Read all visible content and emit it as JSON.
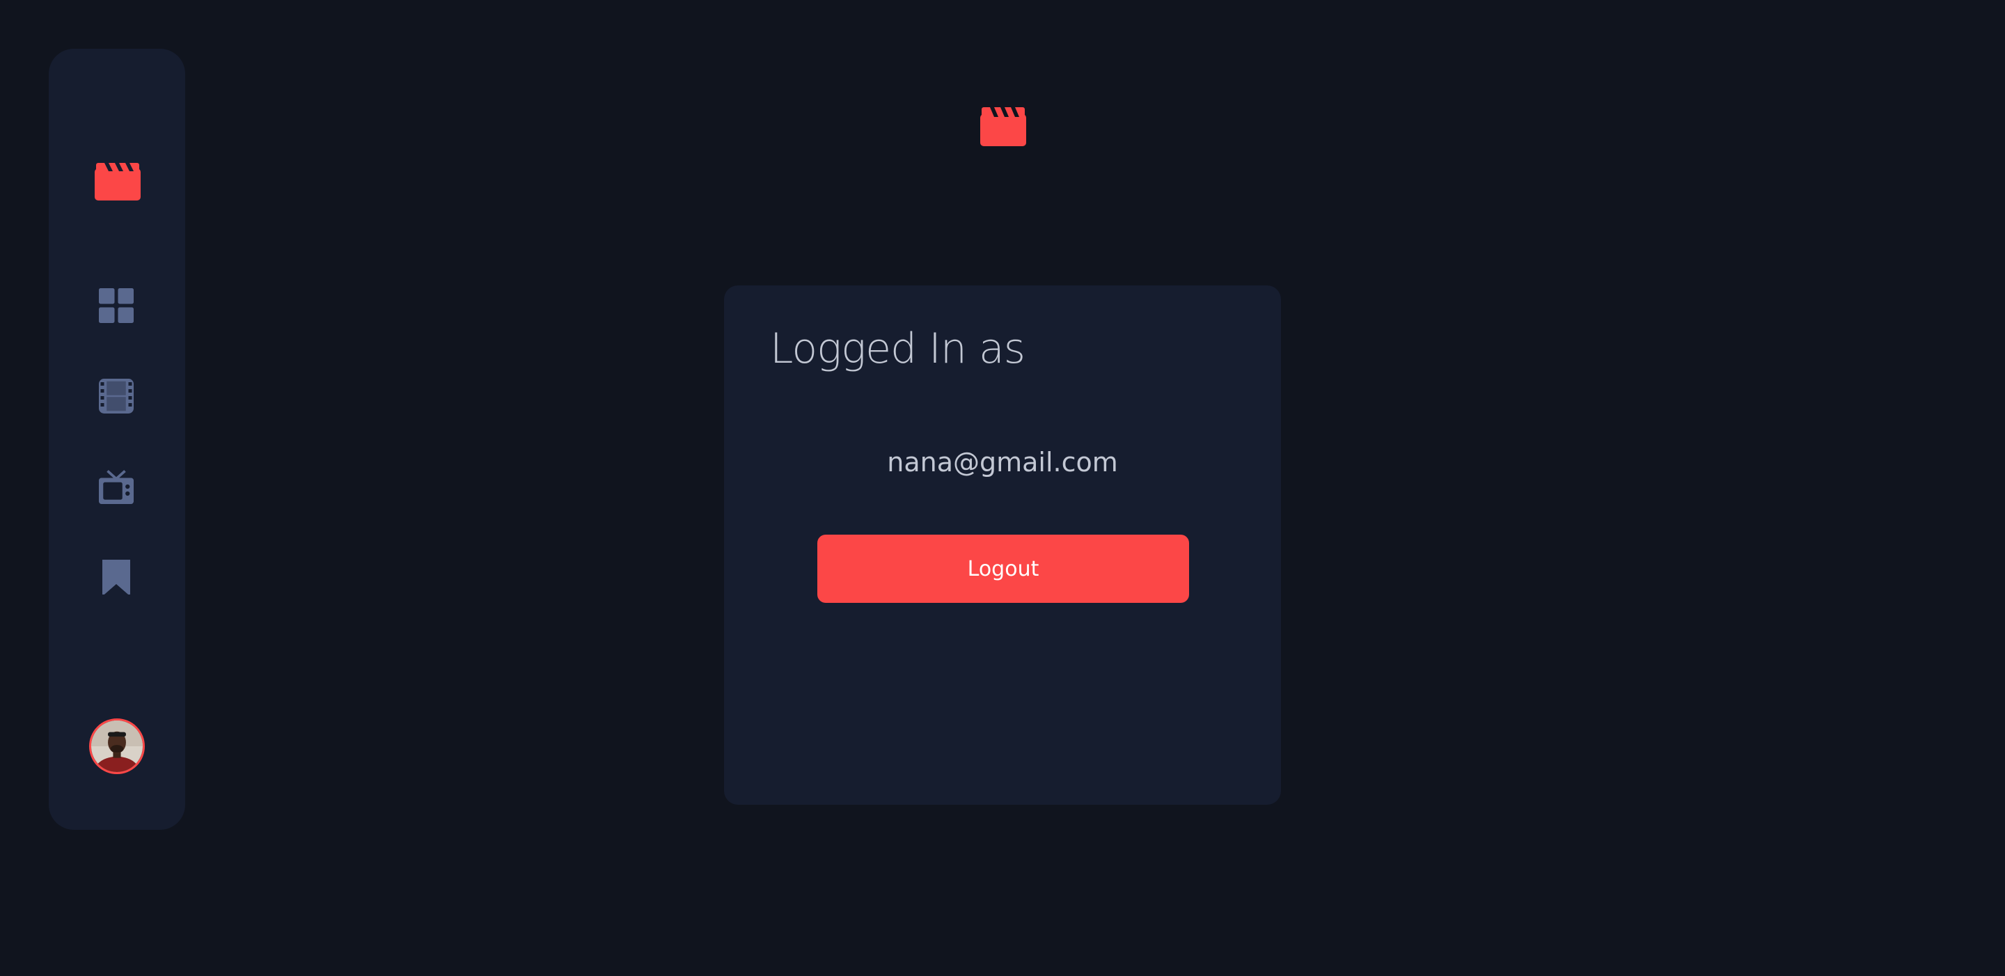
{
  "sidebar": {
    "items": [
      {
        "icon": "home-grid-icon"
      },
      {
        "icon": "movies-film-icon"
      },
      {
        "icon": "tv-series-icon"
      },
      {
        "icon": "bookmark-icon"
      }
    ],
    "avatar_alt": "user avatar"
  },
  "card": {
    "title": "Logged In as",
    "email": "nana@gmail.com",
    "logout_label": "Logout"
  },
  "colors": {
    "background": "#10141E",
    "surface": "#161D2F",
    "accent": "#FC4747",
    "nav_icon": "#5A698F",
    "text": "#C3C8D4"
  }
}
